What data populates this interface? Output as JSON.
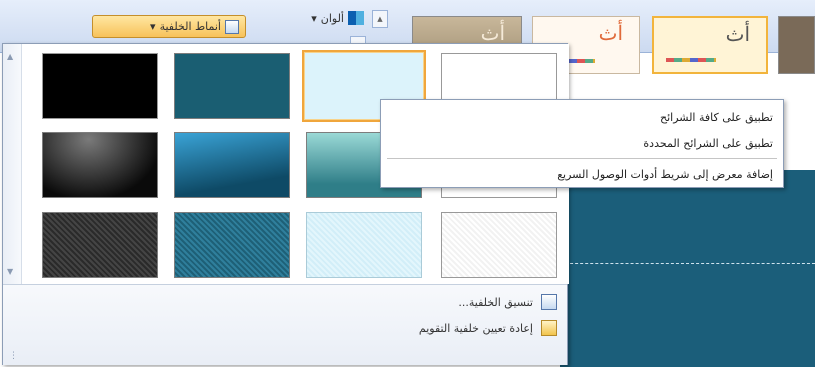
{
  "ribbon": {
    "background_styles_label": "أنماط الخلفية",
    "background_styles_arrow": "▾",
    "colors_label": "ألوان",
    "colors_arrow": "▾",
    "scroll_up_glyph": "▲",
    "themes": [
      "أث",
      "أث",
      "أث"
    ]
  },
  "gallery": {
    "scroll_up_glyph": "▲",
    "scroll_down_glyph": "▼",
    "footer": {
      "format_background": "تنسيق الخلفية...",
      "reset_background": "إعادة تعيين خلفية التقويم"
    },
    "resize_grip_glyph": "⋮"
  },
  "context_menu": {
    "apply_to_all": "تطبيق على كافة الشرائح",
    "apply_to_selected": "تطبيق على الشرائح المحددة",
    "add_to_qat": "إضافة معرض إلى شريط أدوات الوصول السريع"
  },
  "colors": {
    "accent_orange": "#f0a63c",
    "slide_background": "#1b5e7a"
  }
}
